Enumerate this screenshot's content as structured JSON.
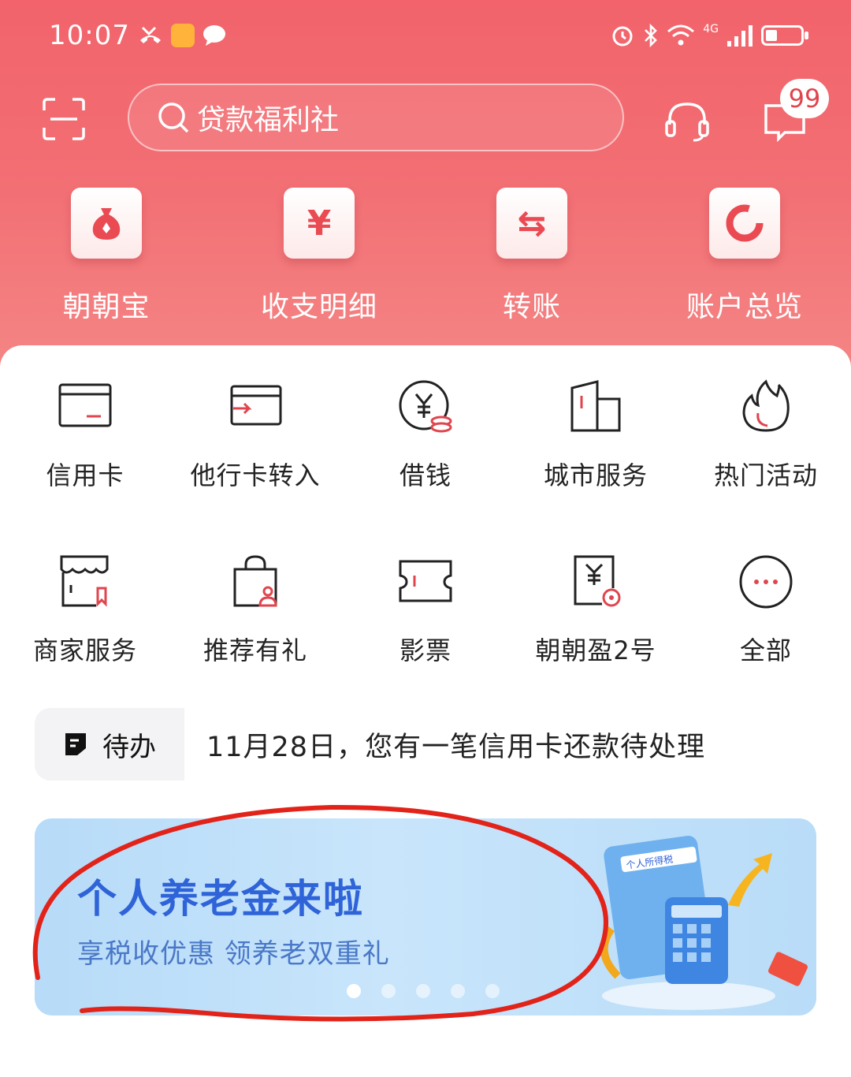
{
  "status_bar": {
    "time": "10:07",
    "network": "4G"
  },
  "search": {
    "placeholder_text": "贷款福利社"
  },
  "message_badge": "99",
  "quick_actions": [
    {
      "label": "朝朝宝",
      "icon": "money-bag-icon"
    },
    {
      "label": "收支明细",
      "icon": "yuan-icon",
      "glyph": "¥"
    },
    {
      "label": "转账",
      "icon": "transfer-arrows-icon",
      "glyph": "⇆"
    },
    {
      "label": "账户总览",
      "icon": "pie-ring-icon"
    }
  ],
  "services_row1": [
    {
      "label": "信用卡",
      "icon": "credit-card-icon"
    },
    {
      "label": "他行卡转入",
      "icon": "card-transfer-in-icon"
    },
    {
      "label": "借钱",
      "icon": "loan-coin-icon"
    },
    {
      "label": "城市服务",
      "icon": "city-buildings-icon"
    },
    {
      "label": "热门活动",
      "icon": "flame-icon"
    }
  ],
  "services_row2": [
    {
      "label": "商家服务",
      "icon": "store-icon"
    },
    {
      "label": "推荐有礼",
      "icon": "gift-bag-icon"
    },
    {
      "label": "影票",
      "icon": "ticket-icon"
    },
    {
      "label": "朝朝盈2号",
      "icon": "fund-doc-icon"
    },
    {
      "label": "全部",
      "icon": "more-dots-icon"
    }
  ],
  "todo": {
    "label": "待办",
    "message": "11月28日，您有一笔信用卡还款待处理"
  },
  "banner": {
    "title": "个人养老金来啦",
    "subtitle": "享税收优惠 领养老双重礼",
    "art_label": "个人所得税",
    "slides": 5,
    "active_slide": 1
  },
  "colors": {
    "brand_red": "#ea4a52",
    "banner_blue": "#2f63d8",
    "annotation_red": "#e2231a"
  }
}
